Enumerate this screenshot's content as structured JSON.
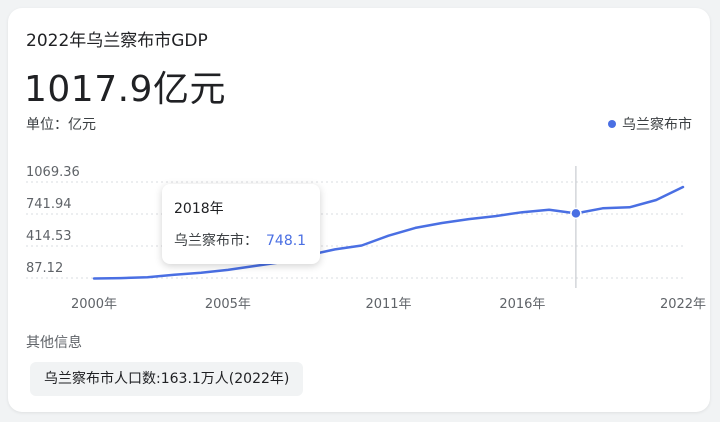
{
  "header": {
    "title": "2022年乌兰察布市GDP",
    "big_value": "1017.9亿元",
    "unit_label": "单位：亿元"
  },
  "colors": {
    "accent": "#4a6fe3",
    "grid": "#dadce0",
    "axis_text": "#5f6368"
  },
  "chart_data": {
    "type": "line",
    "title": "2022年乌兰察布市GDP",
    "ylabel": "单位：亿元",
    "ylim": [
      87.12,
      1069.36
    ],
    "yticks": [
      "1069.36",
      "741.94",
      "414.53",
      "87.12"
    ],
    "ytick_values": [
      1069.36,
      741.94,
      414.53,
      87.12
    ],
    "xtick_labels": [
      "2000年",
      "2005年",
      "2011年",
      "2016年",
      "2022年"
    ],
    "xtick_years": [
      2000,
      2005,
      2011,
      2016,
      2022
    ],
    "legend_position": "top-right",
    "grid": true,
    "x": [
      2000,
      2001,
      2002,
      2003,
      2004,
      2005,
      2006,
      2007,
      2008,
      2009,
      2010,
      2011,
      2012,
      2013,
      2014,
      2015,
      2016,
      2017,
      2018,
      2019,
      2020,
      2021,
      2022
    ],
    "series": [
      {
        "name": "乌兰察布市",
        "values": [
          82,
          86,
          95,
          120,
          140,
          170,
          210,
          250,
          320,
          380,
          420,
          520,
          600,
          650,
          690,
          720,
          760,
          785,
          748.1,
          800,
          810,
          885,
          1017.9
        ]
      }
    ],
    "highlight": {
      "x": 2018,
      "value": 748.1
    }
  },
  "tooltip": {
    "year": "2018年",
    "series_label": "乌兰察布市：",
    "value": "748.1"
  },
  "other_info": {
    "label": "其他信息",
    "chip": "乌兰察布市人口数:163.1万人(2022年)"
  }
}
